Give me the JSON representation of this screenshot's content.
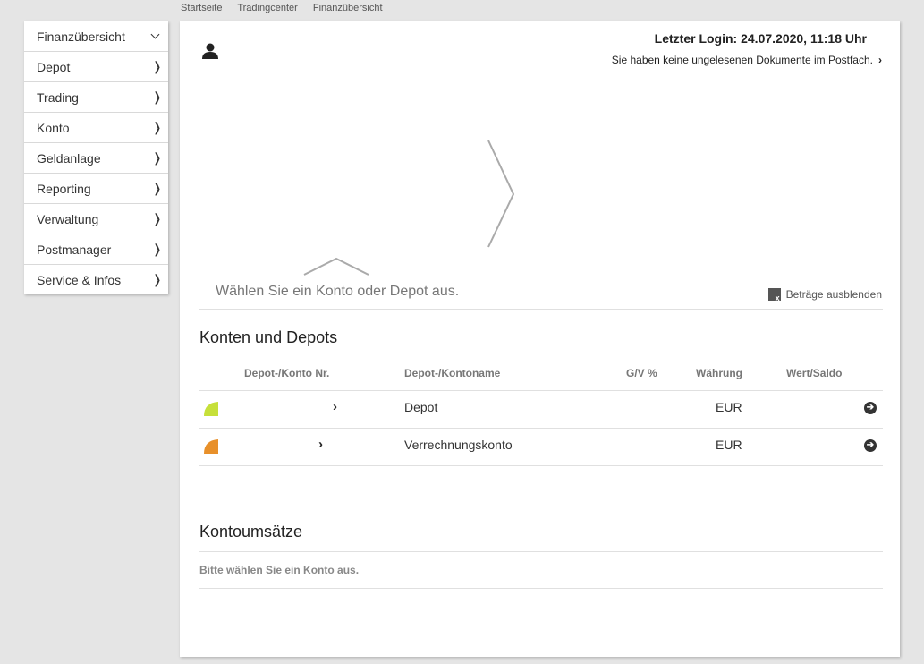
{
  "breadcrumb": [
    "Startseite",
    "Tradingcenter",
    "Finanzübersicht"
  ],
  "sidebar": {
    "items": [
      {
        "label": "Finanzübersicht",
        "chevron": "chevron-down-icon"
      },
      {
        "label": "Depot",
        "chevron": "chevron-right-icon"
      },
      {
        "label": "Trading",
        "chevron": "chevron-right-icon"
      },
      {
        "label": "Konto",
        "chevron": "chevron-right-icon"
      },
      {
        "label": "Geldanlage",
        "chevron": "chevron-right-icon"
      },
      {
        "label": "Reporting",
        "chevron": "chevron-right-icon"
      },
      {
        "label": "Verwaltung",
        "chevron": "chevron-right-icon"
      },
      {
        "label": "Postmanager",
        "chevron": "chevron-right-icon"
      },
      {
        "label": "Service & Infos",
        "chevron": "chevron-right-icon"
      }
    ]
  },
  "header": {
    "last_login": "Letzter Login: 24.07.2020, 11:18 Uhr",
    "inbox_notice": "Sie haben keine ungelesenen Dokumente im Postfach.",
    "inbox_arrow": "›"
  },
  "overview": {
    "select_hint": "Wählen Sie ein Konto oder Depot aus.",
    "hide_amounts": "Beträge ausblenden"
  },
  "accounts": {
    "title": "Konten und Depots",
    "columns": [
      "Depot-/Konto Nr.",
      "Depot-/Kontoname",
      "G/V %",
      "Währung",
      "Wert/Saldo"
    ],
    "rows": [
      {
        "name": "Depot",
        "currency": "EUR",
        "color": "#c6e03a"
      },
      {
        "name": "Verrechnungskonto",
        "currency": "EUR",
        "color": "#e8902a"
      }
    ]
  },
  "transactions": {
    "title": "Kontoumsätze",
    "empty_text": "Bitte wählen Sie ein Konto aus."
  },
  "colors": {
    "background": "#e5e5e5",
    "panel": "#ffffff",
    "depot": "#c6e03a",
    "verrechnung": "#e8902a"
  }
}
